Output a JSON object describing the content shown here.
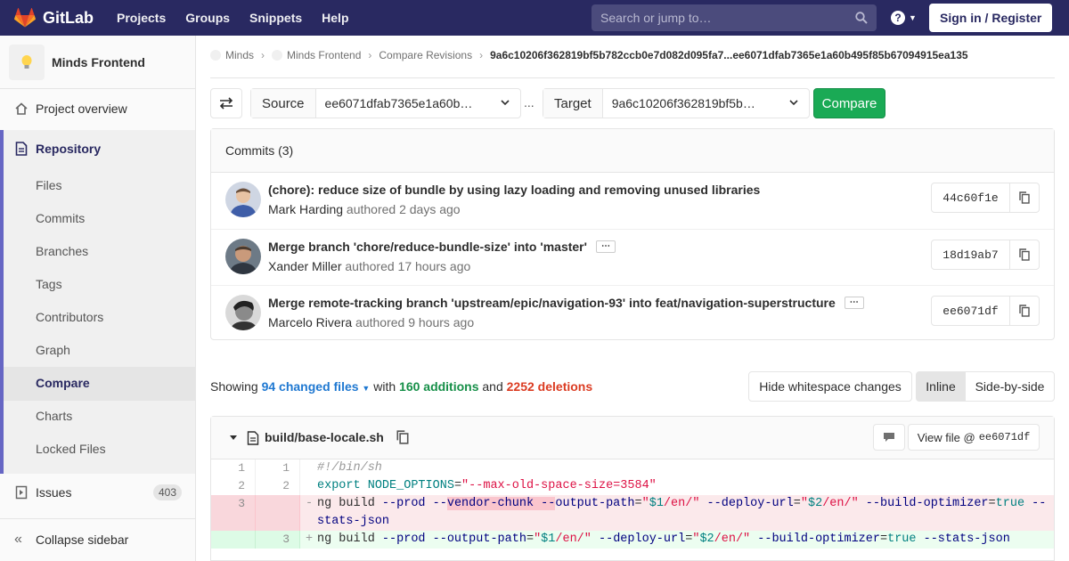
{
  "navbar": {
    "brand": "GitLab",
    "links": [
      "Projects",
      "Groups",
      "Snippets",
      "Help"
    ],
    "search_placeholder": "Search or jump to…",
    "help_glyph": "?",
    "signin_label": "Sign in / Register"
  },
  "sidebar": {
    "project_name": "Minds Frontend",
    "overview": "Project overview",
    "repository": "Repository",
    "repo_items": [
      "Files",
      "Commits",
      "Branches",
      "Tags",
      "Contributors",
      "Graph",
      "Compare",
      "Charts",
      "Locked Files"
    ],
    "active_item": "Compare",
    "issues": "Issues",
    "issues_count": "403",
    "collapse": "Collapse sidebar"
  },
  "breadcrumb": {
    "items": [
      "Minds",
      "Minds Frontend",
      "Compare Revisions"
    ],
    "current": "9a6c10206f362819bf5b782ccb0e7d082d095fa7...ee6071dfab7365e1a60b495f85b67094915ea135"
  },
  "compare": {
    "source_label": "Source",
    "source_value": "ee6071dfab7365e1a60b…",
    "ellipsis": "...",
    "target_label": "Target",
    "target_value": "9a6c10206f362819bf5b…",
    "compare_label": "Compare"
  },
  "commits": {
    "header": "Commits (3)",
    "list": [
      {
        "title": "(chore): reduce size of bundle by using lazy loading and removing unused libraries",
        "author": "Mark Harding",
        "time": "authored 2 days ago",
        "sha": "44c60f1e",
        "more": false
      },
      {
        "title": "Merge branch 'chore/reduce-bundle-size' into 'master'",
        "author": "Xander Miller",
        "time": "authored 17 hours ago",
        "sha": "18d19ab7",
        "more": true
      },
      {
        "title": "Merge remote-tracking branch 'upstream/epic/navigation-93' into feat/navigation-superstructure",
        "author": "Marcelo Rivera",
        "time": "authored 9 hours ago",
        "sha": "ee6071df",
        "more": true
      }
    ]
  },
  "stats": {
    "showing": "Showing",
    "changed": "94 changed files",
    "with": "with",
    "additions": "160 additions",
    "and": "and",
    "deletions": "2252 deletions"
  },
  "toolbar": {
    "whitespace": "Hide whitespace changes",
    "inline": "Inline",
    "side_by_side": "Side-by-side"
  },
  "file": {
    "name": "build/base-locale.sh",
    "view_file": "View file @",
    "view_sha": "ee6071df"
  },
  "diff": [
    {
      "type": "ctx",
      "old": "1",
      "new": "1",
      "sign": ""
    },
    {
      "type": "ctx",
      "old": "2",
      "new": "2",
      "sign": ""
    },
    {
      "type": "del",
      "old": "3",
      "new": "",
      "sign": "-"
    },
    {
      "type": "del-cont",
      "old": "",
      "new": "",
      "sign": ""
    },
    {
      "type": "add",
      "old": "",
      "new": "3",
      "sign": "+"
    }
  ],
  "diff_text": {
    "l1": "#!/bin/sh",
    "l2a": "export",
    "l2b": "NODE_OPTIONS",
    "l2c": "=",
    "l2d": "\"--max-old-space-size=3584\"",
    "l3a": "ng build ",
    "l3b": "--prod",
    "l3c": " ",
    "l3d": "--vendor-chunk",
    "l3e": " ",
    "l3f": "--",
    "l3g": "output-path",
    "l3h": "=",
    "l3i": "\"",
    "l3j": "$1",
    "l3k": "/en/\"",
    "l3l": " --deploy-url",
    "l3m": "=",
    "l3n": "\"",
    "l3o": "$2",
    "l3p": "/en/\"",
    "l3q": " --build-optimizer",
    "l3r": "=",
    "l3s": "true",
    "l3t": " --",
    "l3u": "stats-json",
    "l4a": "ng build ",
    "l4b": "--prod",
    "l4c": " --output-path",
    "l4d": "=",
    "l4e": "\"",
    "l4f": "$1",
    "l4g": "/en/\"",
    "l4h": " --deploy-url",
    "l4i": "=",
    "l4j": "\"",
    "l4k": "$2",
    "l4l": "/en/\"",
    "l4m": " --build-optimizer",
    "l4n": "=",
    "l4o": "true",
    "l4p": " --stats-json"
  },
  "colors": {
    "navbar": "#292961",
    "accent": "#6666c4",
    "green": "#1aaa55",
    "link": "#1f78d1",
    "deletions": "#db3b21"
  }
}
